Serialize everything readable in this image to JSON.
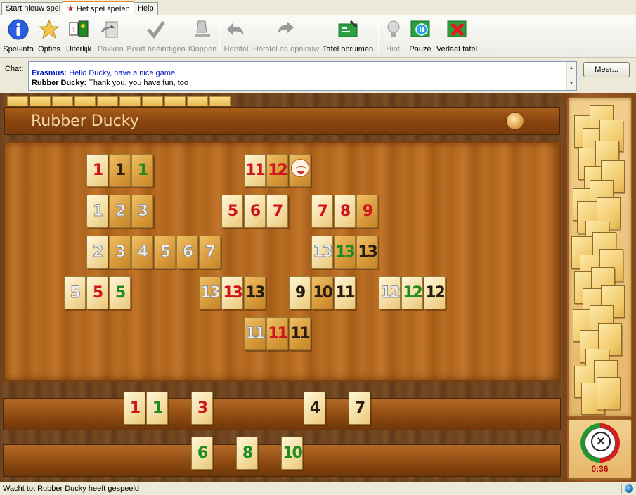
{
  "tabs": [
    {
      "label": "Start nieuw spel"
    },
    {
      "label": "Het spel spelen"
    },
    {
      "label": "Help"
    }
  ],
  "toolbar": {
    "spelinfo": "Spel-info",
    "opties": "Opties",
    "uiterlijk": "Uiterlijk",
    "pakken": "Pakken",
    "beurt": "Beurt beëindigen",
    "kloppen": "Kloppen",
    "herstel": "Herstel",
    "herstel_opnieuw": "Herstel en opnieuw",
    "tafel": "Tafel opruimen",
    "hint": "Hint",
    "pauze": "Pauze",
    "verlaat": "Verlaat tafel"
  },
  "chat": {
    "label": "Chat:",
    "messages": [
      {
        "name": "Erasmus:",
        "text": " Hello Ducky, have a nice game"
      },
      {
        "name": "Rubber Ducky:",
        "text": " Thank you, you have fun, too"
      }
    ],
    "more_button": "Meer..."
  },
  "game": {
    "player_name": "Rubber Ducky",
    "table_tiles": [
      {
        "n": "1",
        "c": "red"
      },
      {
        "n": "1",
        "c": "black"
      },
      {
        "n": "1",
        "c": "green"
      },
      {
        "n": "11",
        "c": "red"
      },
      {
        "n": "12",
        "c": "red"
      },
      {
        "n": "joker",
        "c": "red"
      },
      {
        "n": "1",
        "c": "white"
      },
      {
        "n": "2",
        "c": "white"
      },
      {
        "n": "3",
        "c": "white"
      },
      {
        "n": "5",
        "c": "red"
      },
      {
        "n": "6",
        "c": "red"
      },
      {
        "n": "7",
        "c": "red"
      },
      {
        "n": "7",
        "c": "red"
      },
      {
        "n": "8",
        "c": "red"
      },
      {
        "n": "9",
        "c": "red"
      },
      {
        "n": "2",
        "c": "white"
      },
      {
        "n": "3",
        "c": "white"
      },
      {
        "n": "4",
        "c": "white"
      },
      {
        "n": "5",
        "c": "white"
      },
      {
        "n": "6",
        "c": "white"
      },
      {
        "n": "7",
        "c": "white"
      },
      {
        "n": "13",
        "c": "white"
      },
      {
        "n": "13",
        "c": "green"
      },
      {
        "n": "13",
        "c": "black"
      },
      {
        "n": "5",
        "c": "white"
      },
      {
        "n": "5",
        "c": "red"
      },
      {
        "n": "5",
        "c": "green"
      },
      {
        "n": "13",
        "c": "white"
      },
      {
        "n": "13",
        "c": "red"
      },
      {
        "n": "13",
        "c": "black"
      },
      {
        "n": "9",
        "c": "black"
      },
      {
        "n": "10",
        "c": "black"
      },
      {
        "n": "11",
        "c": "black"
      },
      {
        "n": "12",
        "c": "white"
      },
      {
        "n": "12",
        "c": "green"
      },
      {
        "n": "12",
        "c": "black"
      },
      {
        "n": "11",
        "c": "white"
      },
      {
        "n": "11",
        "c": "red"
      },
      {
        "n": "11",
        "c": "black"
      }
    ],
    "rack_top": [
      {
        "n": "1",
        "c": "red"
      },
      {
        "n": "1",
        "c": "green"
      },
      {
        "n": "3",
        "c": "red"
      },
      {
        "n": "4",
        "c": "black"
      },
      {
        "n": "7",
        "c": "black"
      }
    ],
    "rack_bottom": [
      {
        "n": "6",
        "c": "green"
      },
      {
        "n": "8",
        "c": "green"
      },
      {
        "n": "10",
        "c": "green"
      }
    ],
    "timer": "0:36"
  },
  "status": {
    "text": "Wacht tot Rubber Ducky heeft gespeeld"
  }
}
